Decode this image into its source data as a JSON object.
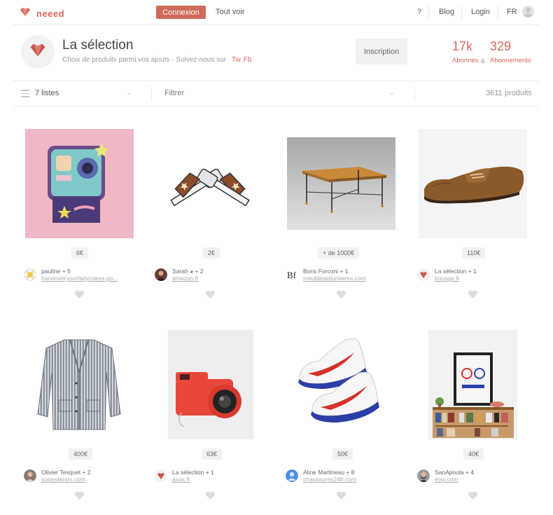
{
  "colors": {
    "accent": "#cf6a5a",
    "heart_gray": "#dddddd"
  },
  "nav": {
    "logo_icon": "heart-gem-icon",
    "logo_text": "neeed",
    "connexion": "Connexion",
    "tout_voir": "Tout voir",
    "help": "?",
    "blog": "Blog",
    "login": "Login",
    "lang": "FR"
  },
  "profile": {
    "title": "La sélection",
    "subtitle": "Choix de produits parmi vos ajouts - Suivez-nous sur",
    "links": [
      "Tw",
      "Fb"
    ],
    "inscription": "Inscription",
    "followers_count": "17k",
    "followers_label": "Abonnés",
    "amp": "&",
    "following_count": "329",
    "following_label": "Abonnements"
  },
  "filterbar": {
    "lists": "7 listes",
    "filter": "Filtrer",
    "count": "3611 produits"
  },
  "products": [
    {
      "image": "camera-patch",
      "price": "6€",
      "by": "pauline + 5",
      "site": "handoveryourfairycakes.go...",
      "avatar": "flower"
    },
    {
      "image": "crossed-pistols",
      "price": "2€",
      "by": "Sarah ◕ + 2",
      "site": "amazon.fr",
      "avatar": "woman"
    },
    {
      "image": "coffee-table",
      "price": "+ de 1000€",
      "by": "Boris Forconi + 1",
      "site": "meublesetlumieres.com",
      "avatar": "bf-logo"
    },
    {
      "image": "brown-shoe",
      "price": "110€",
      "by": "La sélection + 1",
      "site": "bocage.fr",
      "avatar": "selection"
    },
    {
      "image": "striped-jacket",
      "price": "400€",
      "by": "Olivier Tesquet + 2",
      "site": "superdenim.com",
      "avatar": "man"
    },
    {
      "image": "red-camera",
      "price": "63€",
      "by": "La sélection + 1",
      "site": "asos.fr",
      "avatar": "selection"
    },
    {
      "image": "nike-cortez",
      "price": "50€",
      "by": "Aline Martineau + 8",
      "site": "chaussures24fr.com",
      "avatar": "default-blue"
    },
    {
      "image": "france-poster",
      "price": "40€",
      "by": "SanApoula + 4",
      "site": "etsy.com",
      "avatar": "bearded-man"
    }
  ]
}
